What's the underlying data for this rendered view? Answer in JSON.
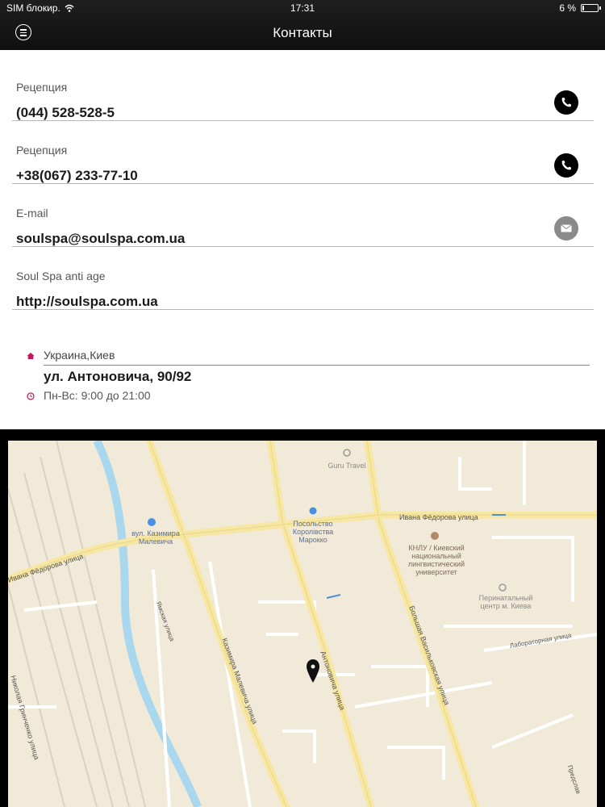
{
  "status_bar": {
    "carrier": "SIM блокир.",
    "time": "17:31",
    "battery": "6 %"
  },
  "nav": {
    "title": "Контакты",
    "menu_icon": "menu-icon"
  },
  "contacts": [
    {
      "label": "Рецепция",
      "value": "(044) 528-528-5",
      "icon": "phone-icon"
    },
    {
      "label": "Рецепция",
      "value": "+38(067) 233-77-10",
      "icon": "phone-icon"
    },
    {
      "label": "E-mail",
      "value": "soulspa@soulspa.com.ua",
      "icon": "mail-icon"
    },
    {
      "label": "Soul Spa anti age",
      "value": "http://soulspa.com.ua"
    }
  ],
  "address": {
    "city": "Украина,Киев",
    "street": "ул. Антоновича, 90/92",
    "hours": "Пн-Вс: 9:00 до 21:00"
  },
  "map": {
    "labels": {
      "guru": "Guru Travel",
      "embassy": "Посольство Королівства Марокко",
      "station": "вул. Казимира Малевича",
      "knlu": "КНЛУ / Киевский национальный лингвистический университет",
      "center": "Перинатальный центр м. Киева"
    },
    "streets": {
      "ivana_top": "Ивана Фёдорова улица",
      "ivana_left": "Ивана Фёдорова улица",
      "yamskaya": "Ямская улица",
      "malevicha": "Казимира Малевича улица",
      "antonovicha": "Антоновича улица",
      "bolshaya": "Большая Васильковская улица",
      "laboratornaya": "Лабораторная улица",
      "grinchenko": "Николая Гринченко улица",
      "predsl": "Предслав"
    }
  },
  "colors": {
    "nav_bg": "#141414",
    "map_bg": "#f2ead8",
    "major_road": "#f7e7a3",
    "water": "#a9d7ee",
    "accent_pink": "#c2185b"
  }
}
